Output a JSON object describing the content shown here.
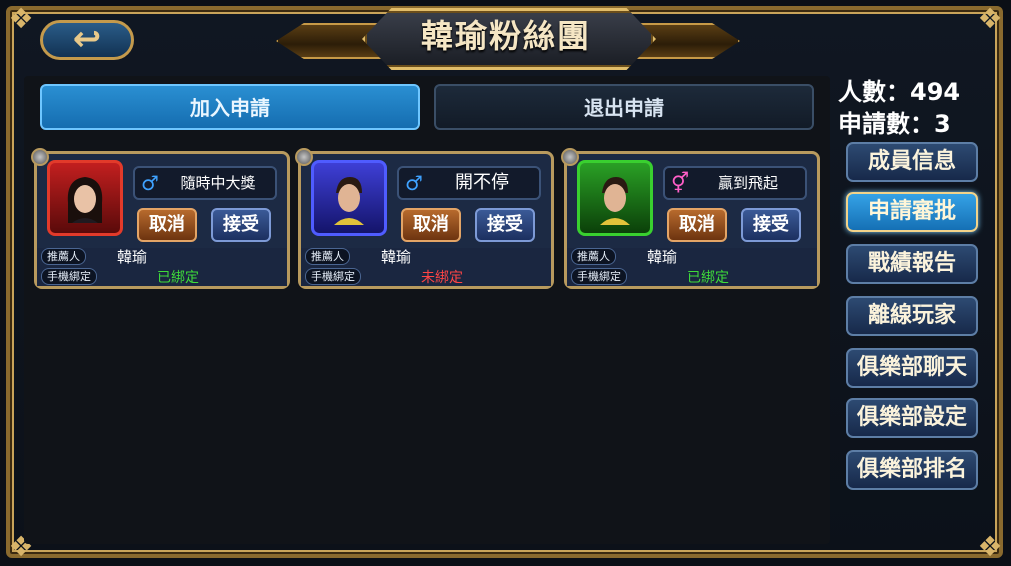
{
  "title": "韓瑜粉絲團",
  "back": {
    "icon": "back-arrow-icon",
    "glyph": "↩"
  },
  "tabs": {
    "join": "加入申請",
    "quit": "退出申請",
    "active": "join"
  },
  "stats": {
    "members": "人數：494",
    "applications": "申請數：3"
  },
  "side_menu": [
    "成員信息",
    "申請審批",
    "戰績報告",
    "離線玩家",
    "俱樂部聊天",
    "俱樂部設定",
    "俱樂部排名"
  ],
  "side_menu_active": "申請審批",
  "card_labels": {
    "cancel": "取消",
    "accept": "接受",
    "referrer_tag": "推薦人",
    "phone_tag": "手機綁定"
  },
  "applicants": [
    {
      "name": "隨時中大獎",
      "gender_icon": "male-icon",
      "gender_glyph": "♂",
      "frame_color": "red",
      "referrer": "韓瑜",
      "phone_status": "已綁定",
      "bound": true
    },
    {
      "name": "開不停",
      "gender_icon": "male-icon",
      "gender_glyph": "♂",
      "frame_color": "blue",
      "referrer": "韓瑜",
      "phone_status": "未綁定",
      "bound": false
    },
    {
      "name": "贏到飛起",
      "gender_icon": "gender-mixed-icon",
      "gender_glyph": "⚥",
      "frame_color": "green",
      "referrer": "韓瑜",
      "phone_status": "已綁定",
      "bound": true
    }
  ]
}
